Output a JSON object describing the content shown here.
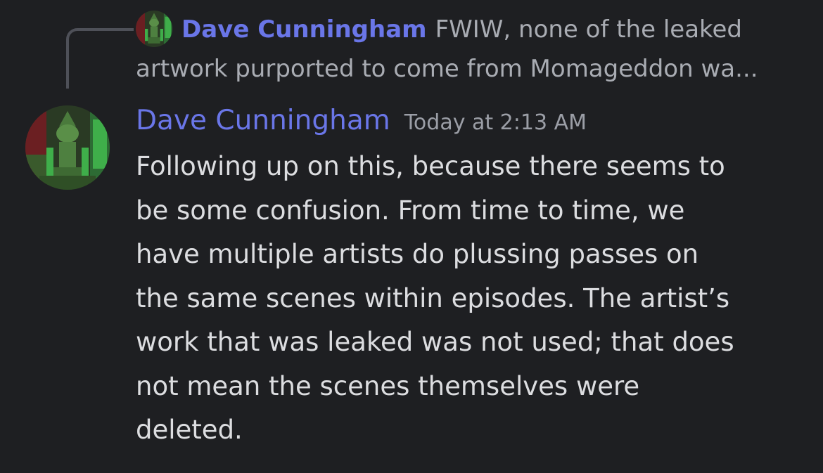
{
  "reply": {
    "author": "Dave Cunningham",
    "preview_line1": "FWIW, none of the leaked",
    "preview_line2": "artwork purported to come from Momageddon wa..."
  },
  "message": {
    "author": "Dave Cunningham",
    "timestamp": "Today at 2:13 AM",
    "lines": [
      "Following up on this, because there seems to",
      "be some confusion. From time to time, we",
      "have multiple artists do plussing passes on",
      "the same scenes within episodes. The artist’s",
      "work that was leaked was not used; that does",
      "not mean the scenes themselves were",
      "deleted."
    ]
  },
  "colors": {
    "background": "#1e1f22",
    "author_name": "#6a76e8",
    "message_text": "#dcdde0",
    "muted_text": "#a9acb3",
    "avatar_green": "#3fae4a"
  }
}
